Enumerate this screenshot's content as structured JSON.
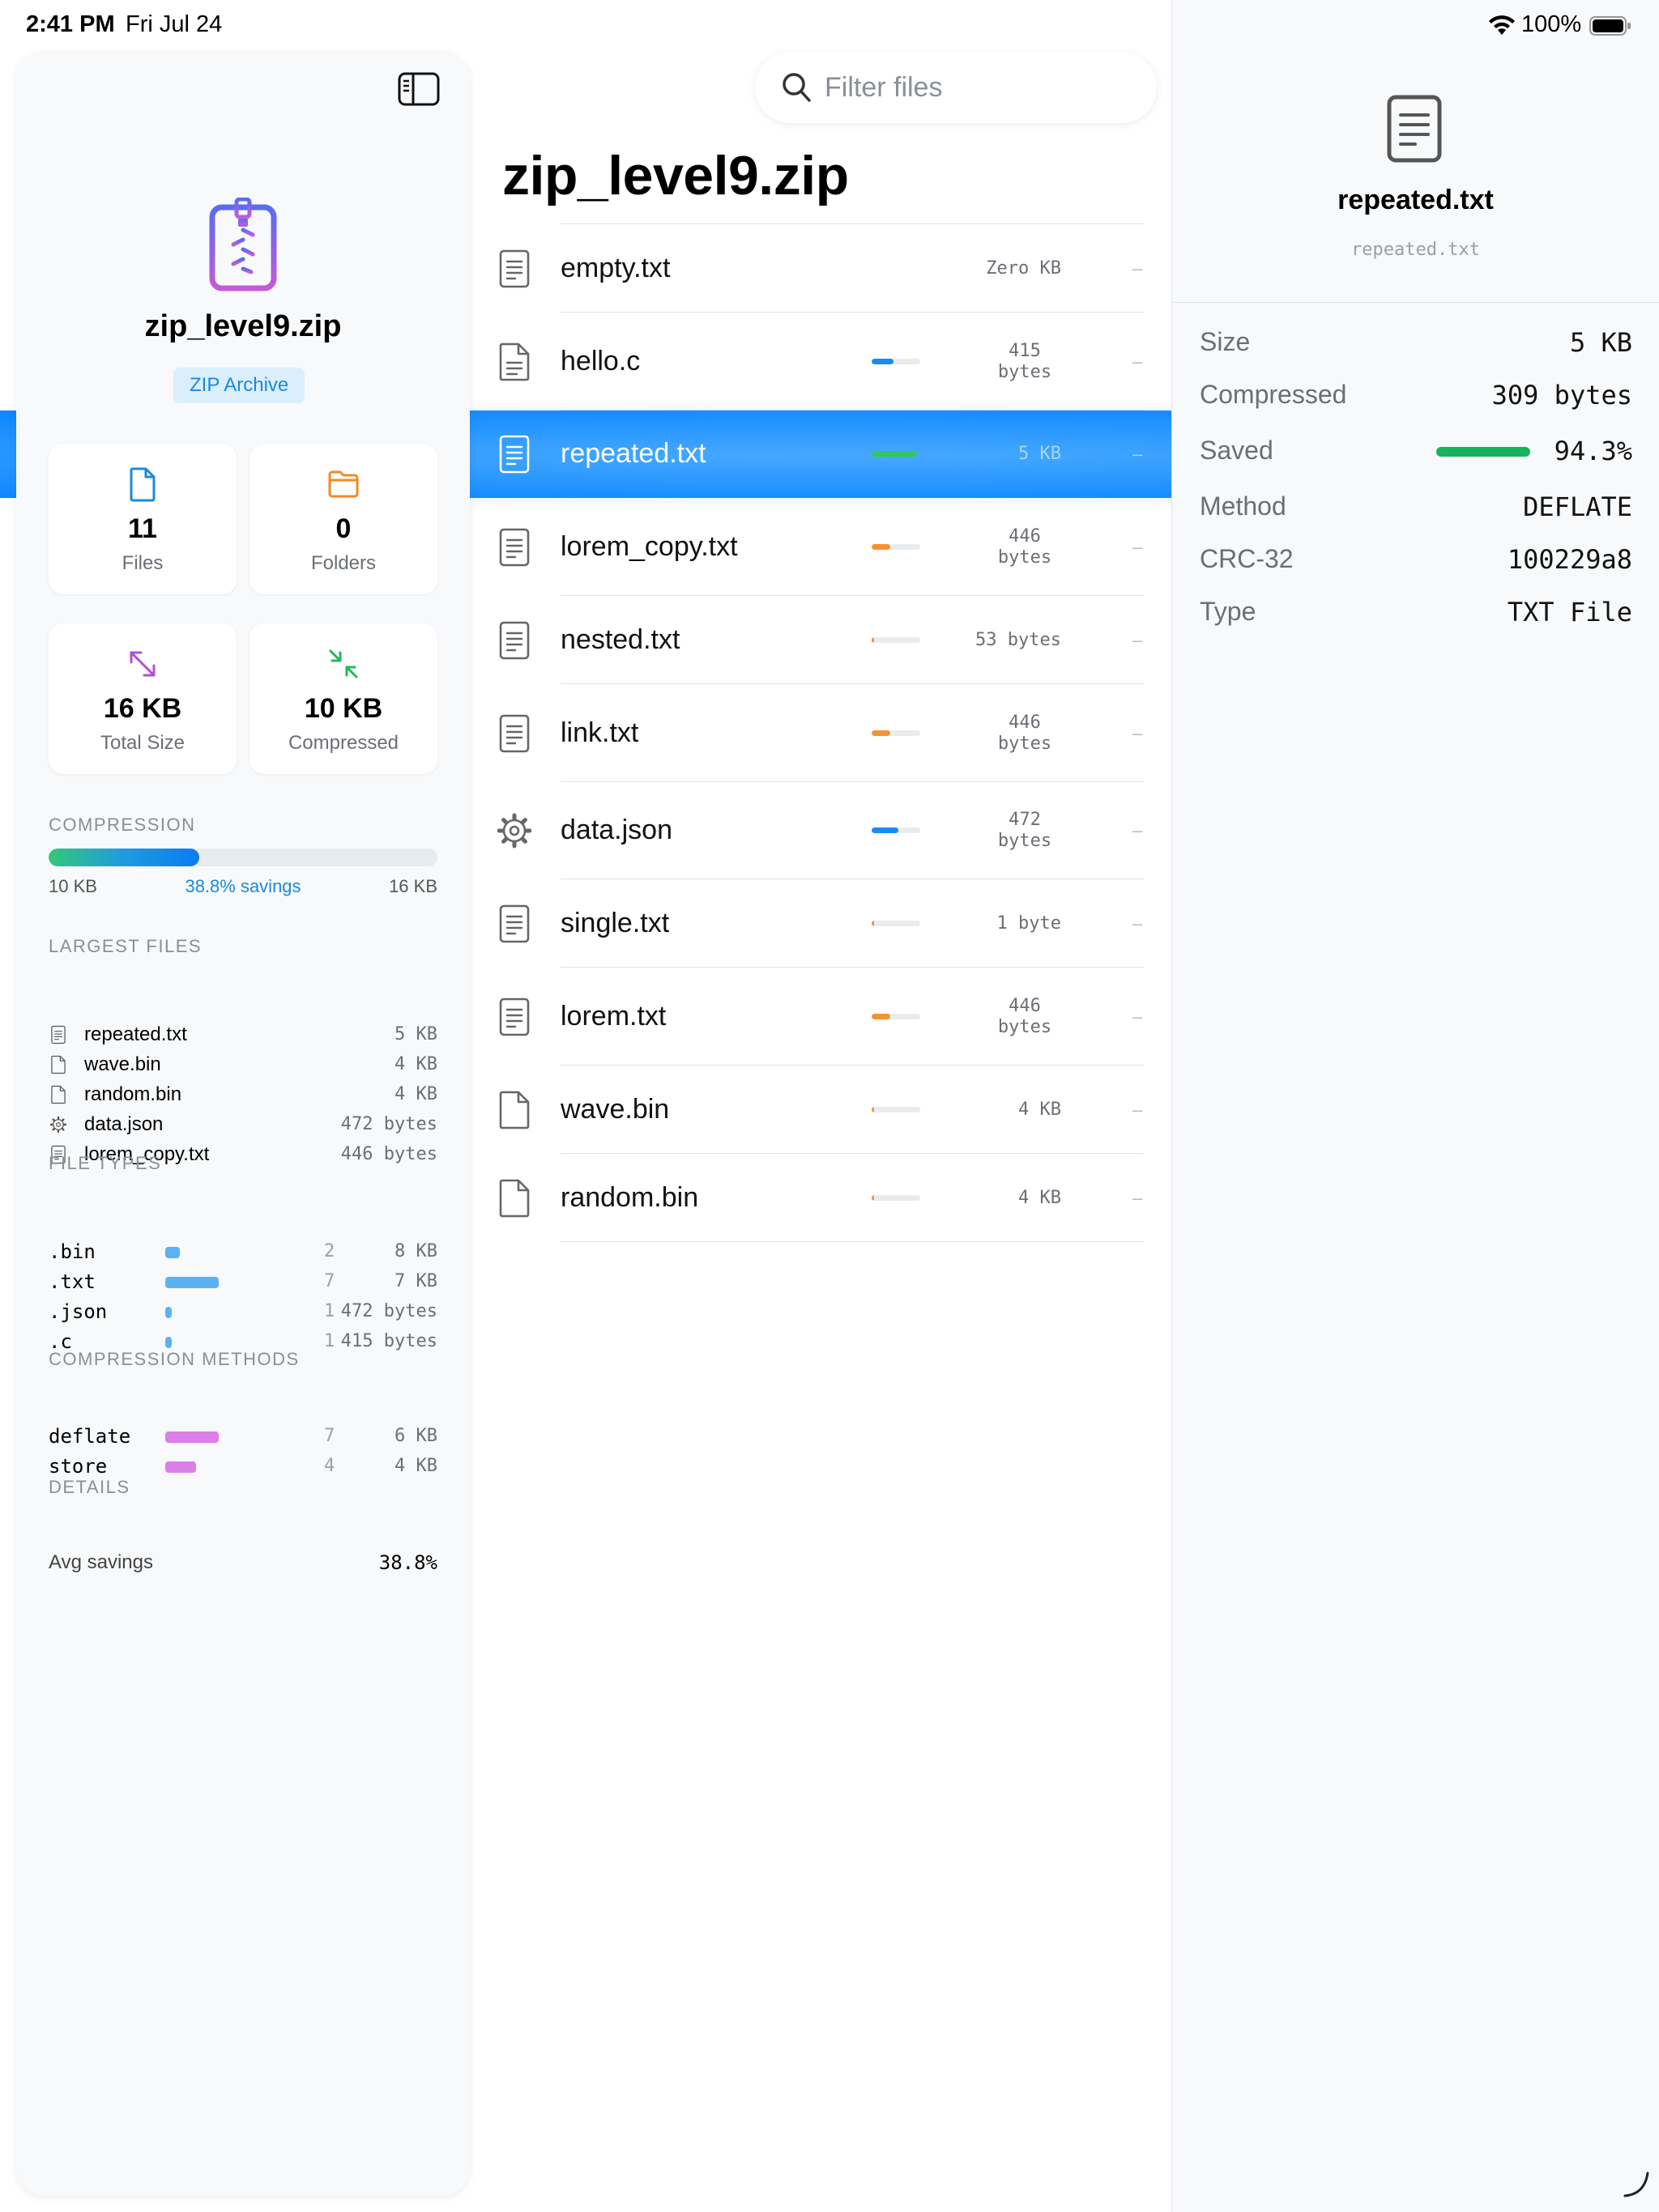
{
  "status": {
    "time": "2:41 PM",
    "date": "Fri Jul 24",
    "battery": "100%",
    "icons": [
      "wifi-icon",
      "battery-icon"
    ]
  },
  "sidebar": {
    "archive_name": "zip_level9.zip",
    "archive_type": "ZIP Archive",
    "stats": [
      {
        "value": "11",
        "label": "Files",
        "icon": "file-icon",
        "color": "#1a8bd8"
      },
      {
        "value": "0",
        "label": "Folders",
        "icon": "folder-icon",
        "color": "#f08a24"
      },
      {
        "value": "16 KB",
        "label": "Total Size",
        "icon": "expand-icon",
        "color": "#b04fd6"
      },
      {
        "value": "10 KB",
        "label": "Compressed",
        "icon": "compress-icon",
        "color": "#28b463"
      }
    ],
    "compression": {
      "title": "COMPRESSION",
      "compressed": "10 KB",
      "savings": "38.8% savings",
      "total": "16 KB",
      "fraction": 0.388
    },
    "largest_files": {
      "title": "LARGEST FILES",
      "items": [
        {
          "name": "repeated.txt",
          "size": "5 KB",
          "icon": "text-file-icon"
        },
        {
          "name": "wave.bin",
          "size": "4 KB",
          "icon": "file-icon"
        },
        {
          "name": "random.bin",
          "size": "4 KB",
          "icon": "file-icon"
        },
        {
          "name": "data.json",
          "size": "472 bytes",
          "icon": "gear-icon"
        },
        {
          "name": "lorem_copy.txt",
          "size": "446 bytes",
          "icon": "text-file-icon"
        }
      ]
    },
    "file_types": {
      "title": "FILE TYPES",
      "items": [
        {
          "ext": ".bin",
          "count": "2",
          "size": "8 KB",
          "share": 0.27,
          "color": "#5ab2f3"
        },
        {
          "ext": ".txt",
          "count": "7",
          "size": "7 KB",
          "share": 1.0,
          "color": "#5ab2f3"
        },
        {
          "ext": ".json",
          "count": "1",
          "size": "472 bytes",
          "share": 0.1,
          "color": "#5ab2f3"
        },
        {
          "ext": ".c",
          "count": "1",
          "size": "415 bytes",
          "share": 0.1,
          "color": "#5ab2f3"
        }
      ]
    },
    "methods": {
      "title": "COMPRESSION METHODS",
      "items": [
        {
          "name": "deflate",
          "count": "7",
          "size": "6 KB",
          "share": 1.0,
          "color": "#dc7ee8"
        },
        {
          "name": "store",
          "count": "4",
          "size": "4 KB",
          "share": 0.57,
          "color": "#dc7ee8"
        }
      ]
    },
    "details": {
      "title": "DETAILS",
      "avg_label": "Avg savings",
      "avg_value": "38.8%"
    }
  },
  "search": {
    "placeholder": "Filter files",
    "value": ""
  },
  "list": {
    "title": "zip_level9.zip",
    "files": [
      {
        "name": "empty.txt",
        "icon": "text-file-icon",
        "size": "Zero KB",
        "ratio": null,
        "bar_color": null,
        "method": "–"
      },
      {
        "name": "hello.c",
        "icon": "code-file-icon",
        "size": "415 bytes",
        "ratio": 0.45,
        "bar_color": "#1a8bf0",
        "method": "–"
      },
      {
        "name": "repeated.txt",
        "icon": "text-file-icon",
        "size": "5 KB",
        "ratio": 0.94,
        "bar_color": "#34c759",
        "method": "–",
        "selected": true
      },
      {
        "name": "lorem_copy.txt",
        "icon": "text-file-icon",
        "size": "446 bytes",
        "ratio": 0.38,
        "bar_color": "#f59331",
        "method": "–"
      },
      {
        "name": "nested.txt",
        "icon": "text-file-icon",
        "size": "53 bytes",
        "ratio": 0.05,
        "bar_color": "#f59331",
        "method": "–"
      },
      {
        "name": "link.txt",
        "icon": "text-file-icon",
        "size": "446 bytes",
        "ratio": 0.38,
        "bar_color": "#f59331",
        "method": "–"
      },
      {
        "name": "data.json",
        "icon": "gear-icon",
        "size": "472 bytes",
        "ratio": 0.55,
        "bar_color": "#1a8bf0",
        "method": "–"
      },
      {
        "name": "single.txt",
        "icon": "text-file-icon",
        "size": "1 byte",
        "ratio": 0.04,
        "bar_color": "#f59331",
        "method": "–"
      },
      {
        "name": "lorem.txt",
        "icon": "text-file-icon",
        "size": "446 bytes",
        "ratio": 0.38,
        "bar_color": "#f59331",
        "method": "–"
      },
      {
        "name": "wave.bin",
        "icon": "file-icon",
        "size": "4 KB",
        "ratio": 0.04,
        "bar_color": "#f59331",
        "method": "–"
      },
      {
        "name": "random.bin",
        "icon": "file-icon",
        "size": "4 KB",
        "ratio": 0.04,
        "bar_color": "#f59331",
        "method": "–"
      }
    ]
  },
  "detail": {
    "name": "repeated.txt",
    "path": "repeated.txt",
    "icon": "text-file-icon",
    "rows": [
      {
        "label": "Size",
        "value": "5 KB"
      },
      {
        "label": "Compressed",
        "value": "309 bytes"
      },
      {
        "label": "Saved",
        "value": "94.3%",
        "fraction": 0.943,
        "bar_color": "#16b35a"
      },
      {
        "label": "Method",
        "value": "DEFLATE"
      },
      {
        "label": "CRC-32",
        "value": "100229a8"
      },
      {
        "label": "Type",
        "value": "TXT File"
      }
    ]
  }
}
